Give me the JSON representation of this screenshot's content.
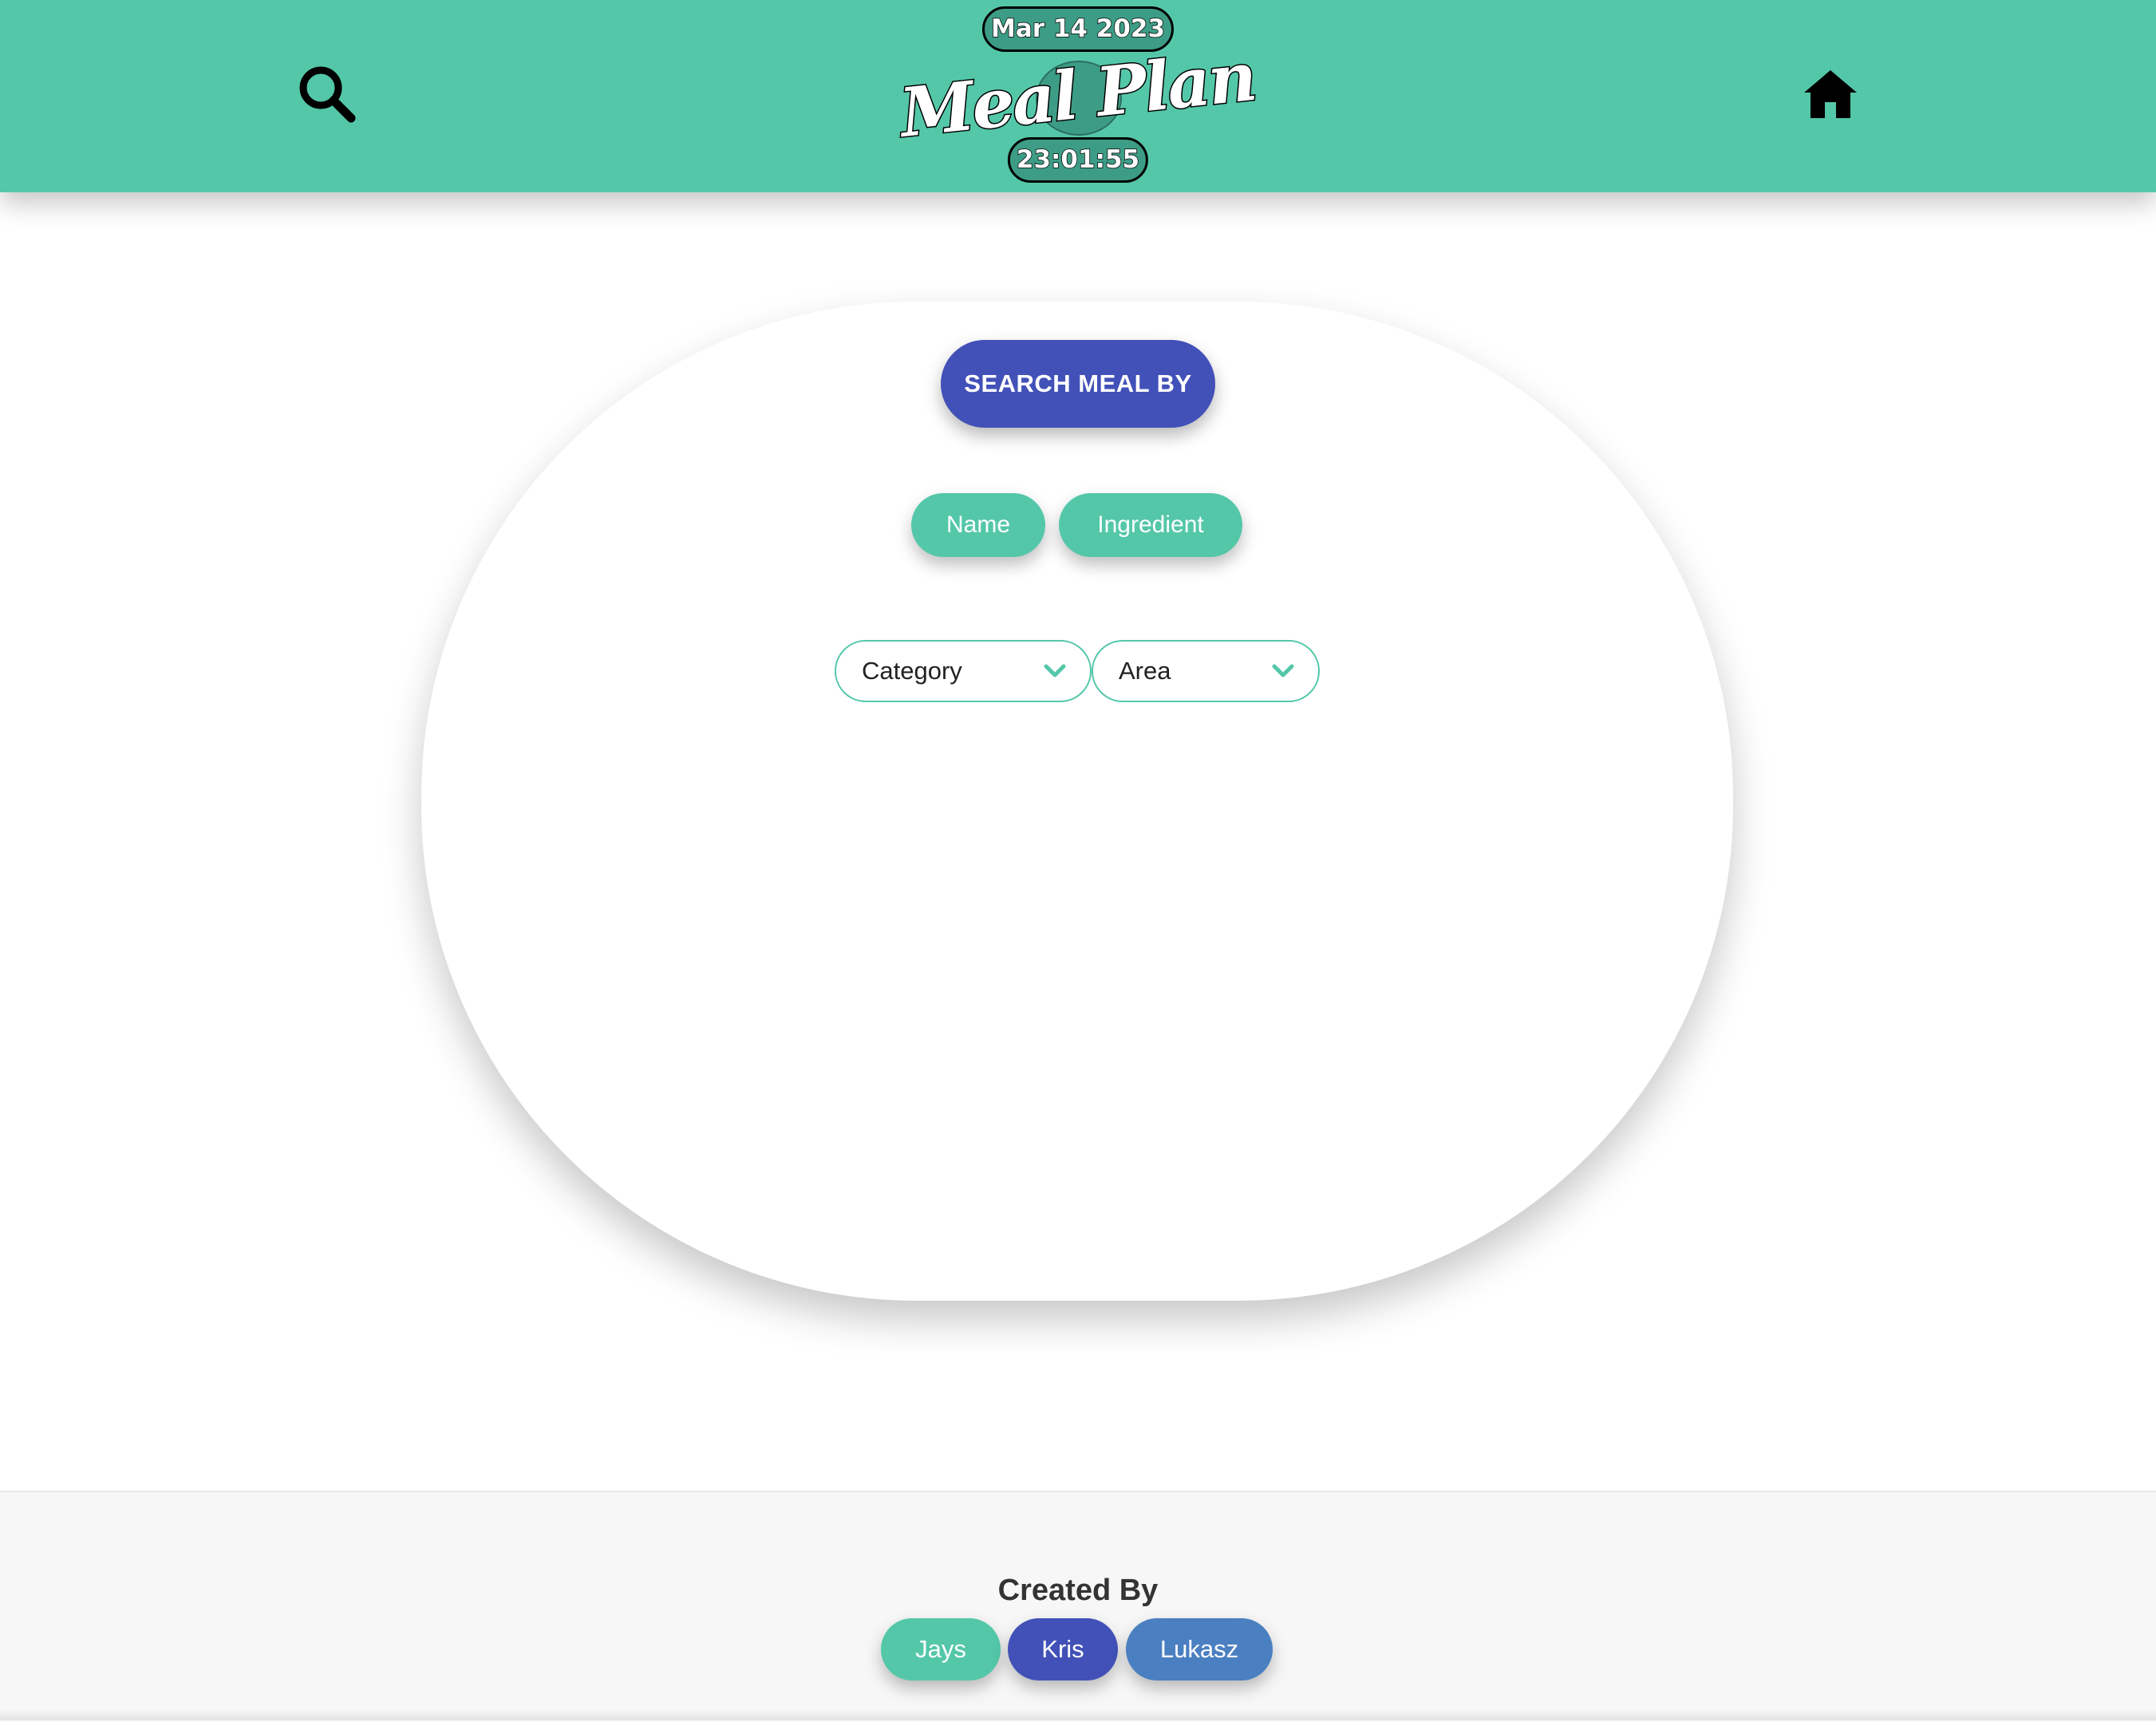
{
  "header": {
    "date": "Mar 14 2023",
    "logo_text": "Meal Plan",
    "time": "23:01:55",
    "search_icon": "search-icon",
    "home_icon": "home-icon",
    "bg_color": "#54c7a9"
  },
  "main": {
    "search_by_label": "SEARCH MEAL BY",
    "options": [
      "Name",
      "Ingredient"
    ],
    "filters": {
      "category": {
        "value": "Category",
        "icon": "chevron-down-icon"
      },
      "area": {
        "value": "Area",
        "icon": "chevron-down-icon"
      }
    }
  },
  "footer": {
    "created_by_label": "Created By",
    "authors": [
      {
        "name": "Jays",
        "color": "#54c7a9"
      },
      {
        "name": "Kris",
        "color": "#4251b8"
      },
      {
        "name": "Lukasz",
        "color": "#4a7fc1"
      }
    ]
  },
  "colors": {
    "accent": "#54c7a9",
    "primary_button": "#4251b8",
    "secondary_blue": "#4a7fc1"
  }
}
